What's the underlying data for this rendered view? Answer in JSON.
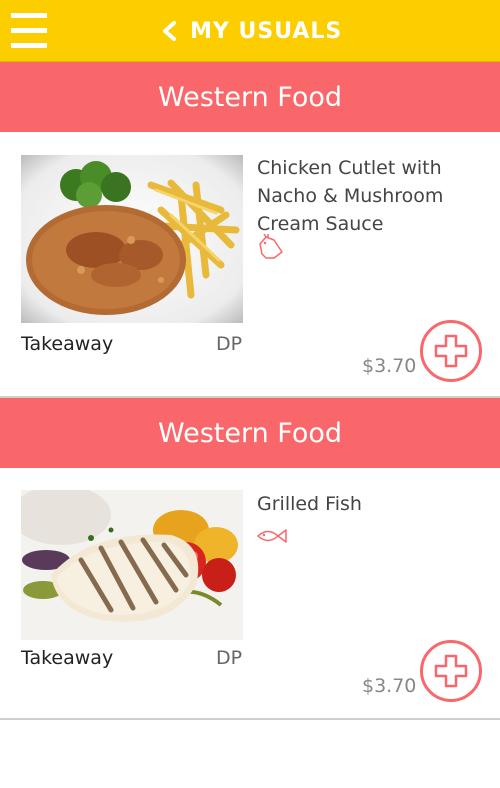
{
  "header": {
    "title": "MY USUALS",
    "menu_icon": "hamburger-menu-icon",
    "back_icon": "chevron-left-icon",
    "bg_color": "#fcce00"
  },
  "accent_color": "#f9676a",
  "sections": [
    {
      "category": "Western Food",
      "item": {
        "name": "Chicken Cutlet with Nacho & Mushroom Cream Sauce",
        "type_icon": "chicken-icon",
        "image": "chicken-cutlet-with-fries-image",
        "service": "Takeaway",
        "stall_code": "DP",
        "price": "$3.70",
        "add_icon": "plus-icon"
      }
    },
    {
      "category": "Western Food",
      "item": {
        "name": "Grilled Fish",
        "type_icon": "fish-icon",
        "image": "grilled-fish-with-vegetables-image",
        "service": "Takeaway",
        "stall_code": "DP",
        "price": "$3.70",
        "add_icon": "plus-icon"
      }
    }
  ]
}
